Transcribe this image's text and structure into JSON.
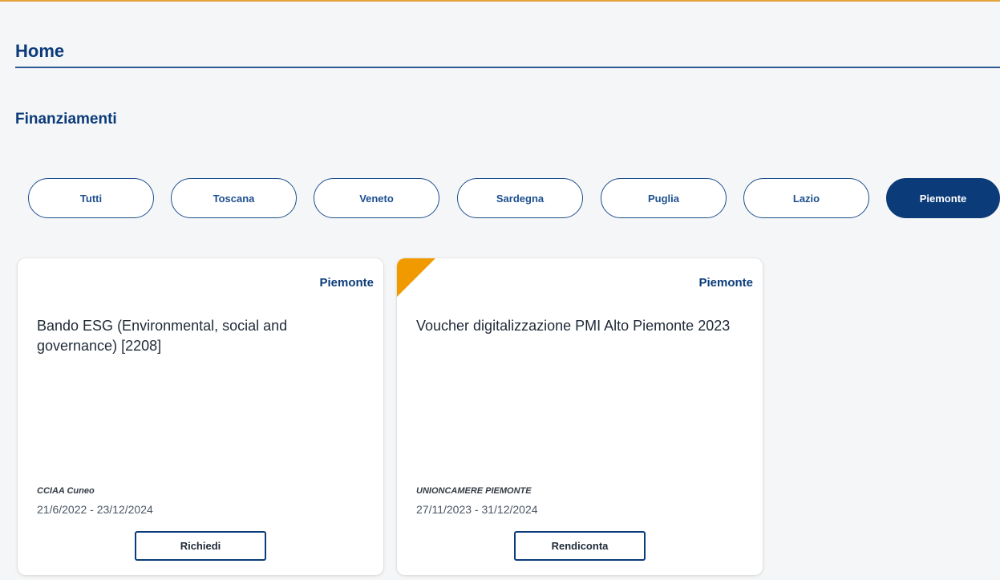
{
  "page": {
    "title": "Home",
    "section_title": "Finanziamenti"
  },
  "filters": [
    {
      "label": "Tutti",
      "active": false
    },
    {
      "label": "Toscana",
      "active": false
    },
    {
      "label": "Veneto",
      "active": false
    },
    {
      "label": "Sardegna",
      "active": false
    },
    {
      "label": "Puglia",
      "active": false
    },
    {
      "label": "Lazio",
      "active": false
    },
    {
      "label": "Piemonte",
      "active": true
    }
  ],
  "cards": [
    {
      "region": "Piemonte",
      "title": "Bando ESG (Environmental, social and governance) [2208]",
      "issuer": "CCIAA Cuneo",
      "dates": "21/6/2022 - 23/12/2024",
      "action_label": "Richiedi",
      "flagged": false
    },
    {
      "region": "Piemonte",
      "title": "Voucher digitalizzazione PMI Alto Piemonte 2023",
      "issuer": "UNIONCAMERE PIEMONTE",
      "dates": "27/11/2023 - 31/12/2024",
      "action_label": "Rendiconta",
      "flagged": true
    }
  ],
  "colors": {
    "accent_top_rule": "#e3a23a",
    "brand_blue": "#0b3b79",
    "flag_orange": "#f09a00"
  }
}
